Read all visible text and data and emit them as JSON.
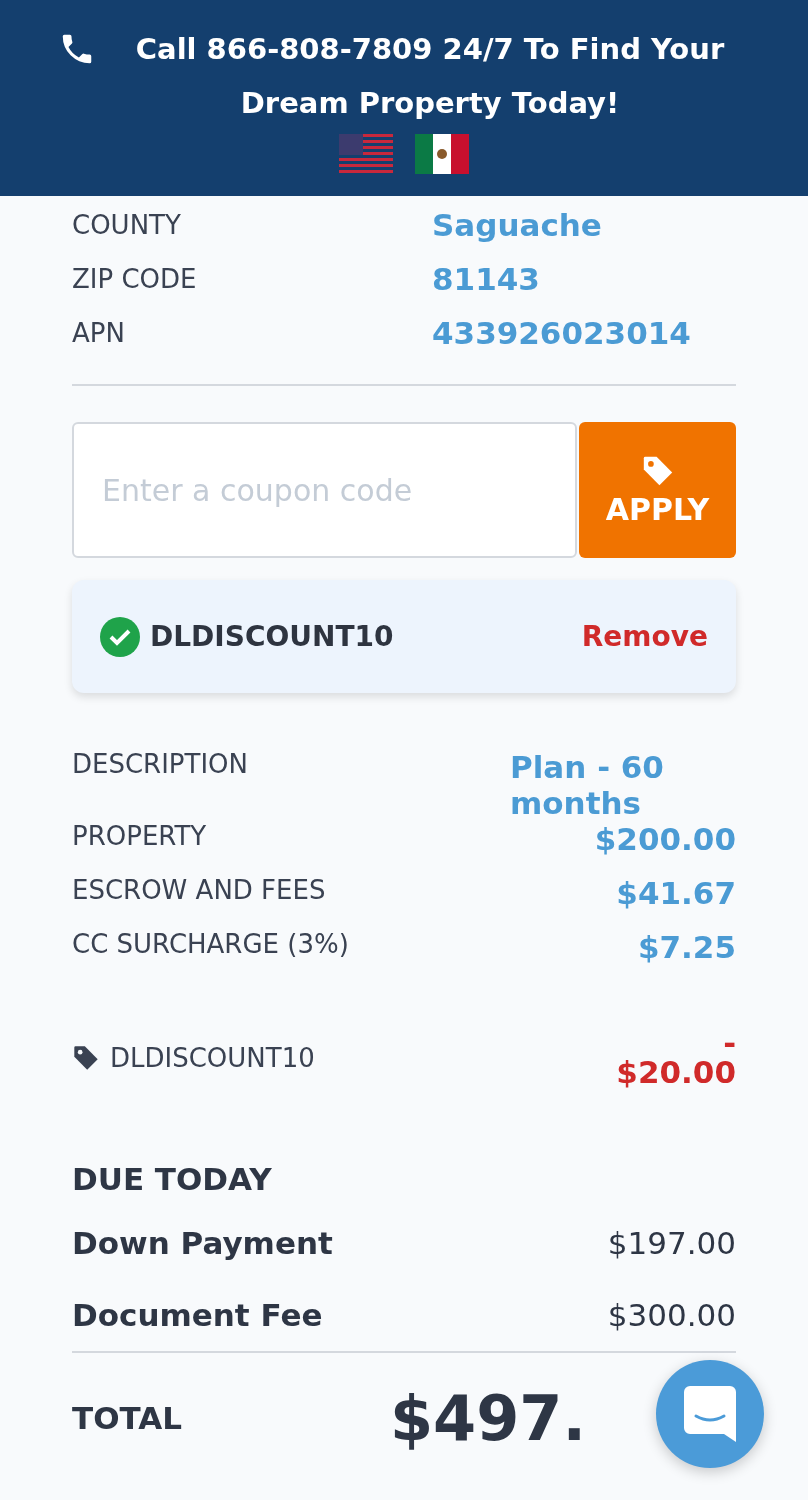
{
  "banner": {
    "text": "Call 866-808-7809 24/7 To Find Your Dream Property Today!",
    "flags": [
      {
        "kind": "us"
      },
      {
        "kind": "mx"
      }
    ]
  },
  "property_details": [
    {
      "label": "COUNTY",
      "value": "Saguache"
    },
    {
      "label": "ZIP CODE",
      "value": "81143"
    },
    {
      "label": "APN",
      "value": "433926023014"
    }
  ],
  "coupon": {
    "placeholder": "Enter a coupon code",
    "button": "APPLY"
  },
  "applied_coupon": {
    "code": "DLDISCOUNT10",
    "action": "Remove"
  },
  "summary": [
    {
      "label": "DESCRIPTION",
      "value": "Plan - 60 months"
    },
    {
      "label": "PROPERTY",
      "value": "$200.00"
    },
    {
      "label": "ESCROW AND FEES",
      "value": "$41.67"
    },
    {
      "label": "CC SURCHARGE (3%)",
      "value": "$7.25"
    }
  ],
  "discount": {
    "code": "DLDISCOUNT10",
    "sign": "-",
    "amount": "$20.00"
  },
  "due_today": {
    "title": "DUE TODAY",
    "items": [
      {
        "label": "Down Payment",
        "value": "$197.00"
      },
      {
        "label": "Document Fee",
        "value": "$300.00"
      }
    ]
  },
  "total": {
    "label": "TOTAL",
    "amount": "$497."
  }
}
